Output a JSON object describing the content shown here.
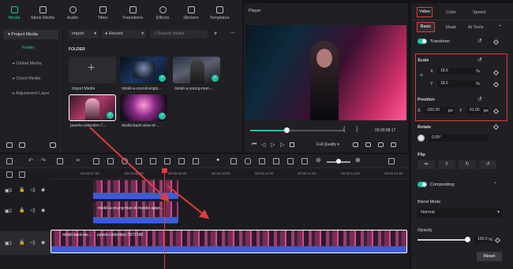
{
  "toolbar": {
    "tabs": [
      {
        "label": "Media"
      },
      {
        "label": "Stock Media"
      },
      {
        "label": "Audio"
      },
      {
        "label": "Titles"
      },
      {
        "label": "Transitions"
      },
      {
        "label": "Effects"
      },
      {
        "label": "Stickers"
      },
      {
        "label": "Templates"
      }
    ]
  },
  "sidebar": {
    "project_media": "Project Media",
    "items": [
      {
        "label": "Folder"
      },
      {
        "label": "Global Media"
      },
      {
        "label": "Cloud Media"
      },
      {
        "label": "Adjustment Layer"
      }
    ]
  },
  "media": {
    "import_label": "Import",
    "record_label": "Record",
    "search_placeholder": "Search media",
    "folder_label": "FOLDER",
    "items": [
      {
        "name": "Import Media"
      },
      {
        "name": "miskit-a-sound-engin..."
      },
      {
        "name": "miskit-a-young-man-..."
      },
      {
        "name": "pexels-cottonbro-7..."
      },
      {
        "name": "miskit-back-view-of-..."
      }
    ]
  },
  "player": {
    "title": "Player",
    "time": "00:00:08:17",
    "quality": "Full Quality"
  },
  "inspector": {
    "tabs": [
      {
        "label": "Video"
      },
      {
        "label": "Color"
      },
      {
        "label": "Speed"
      }
    ],
    "subtabs": [
      {
        "label": "Basic"
      },
      {
        "label": "Mask"
      },
      {
        "label": "AI Tools"
      }
    ],
    "transform_label": "Transform",
    "scale": {
      "label": "Scale",
      "x_label": "X",
      "x_value": "18.6",
      "x_unit": "%",
      "y_label": "Y",
      "y_value": "18.6",
      "y_unit": "%"
    },
    "position": {
      "label": "Position",
      "x_label": "X",
      "x_value": "-102.00",
      "x_unit": "px",
      "y_label": "Y",
      "y_value": "41.00",
      "y_unit": "px"
    },
    "rotate": {
      "label": "Rotate",
      "value": "0.00°"
    },
    "flip_label": "Flip",
    "compositing_label": "Compositing",
    "blend_mode": {
      "label": "Blend Mode",
      "value": "Normal"
    },
    "opacity": {
      "label": "Opacity",
      "value": "100.0",
      "unit": "%"
    },
    "reset_label": "Reset"
  },
  "timeline": {
    "ruler": [
      "00:00:07:00",
      "00:00:08:00",
      "00:00:09:00",
      "00:00:10:00",
      "00:00:11:00",
      "00:00:12:00",
      "00:00:13:00",
      "00:00:14:00"
    ],
    "track_numbers": [
      "3",
      "2",
      "1"
    ],
    "clips": [
      {
        "title": "miskit-a-young-man-in-hoodie-appe..."
      },
      {
        "title": "pexels-cottonbro-7972148"
      },
      {
        "title": "miskit-back-vie..."
      }
    ]
  },
  "colors": {
    "accent": "#1fc1a8",
    "highlight_red": "#e23b3b",
    "audio_blue": "#3e5bd6"
  }
}
